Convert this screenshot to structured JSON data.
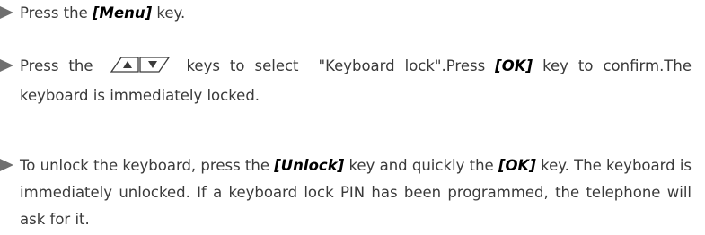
{
  "steps": [
    {
      "parts": [
        "Press the ",
        "[Menu]",
        " key."
      ]
    },
    {
      "parts": [
        "Press the ",
        " keys to select  \"Keyboard lock\".Press ",
        "[OK]",
        " key to confirm.The keyboard is immediately locked."
      ],
      "icons": [
        "up-arrow-key-icon",
        "down-arrow-key-icon"
      ]
    },
    {
      "parts": [
        "To unlock the keyboard, press the ",
        "[Unlock]",
        " key and quickly the ",
        "[OK]",
        " key. The keyboard is immediately unlocked. If a keyboard lock PIN has been programmed, the telephone will ask for it."
      ]
    }
  ],
  "colors": {
    "text": "#3a3a3a",
    "bullet": "#6f6f6f",
    "key": "#000000"
  }
}
